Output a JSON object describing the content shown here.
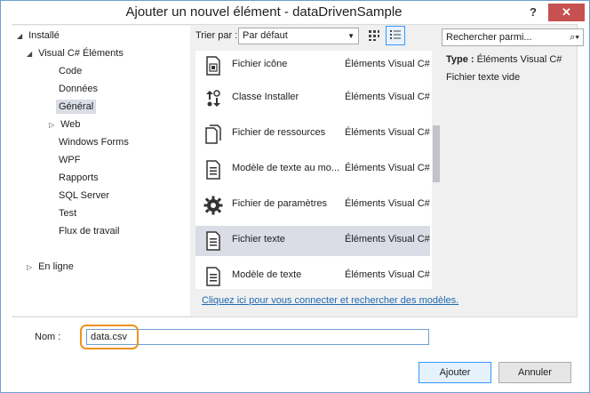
{
  "window": {
    "title": "Ajouter un nouvel élément - dataDrivenSample",
    "help_glyph": "?",
    "close_glyph": "✕"
  },
  "tree": {
    "items": [
      {
        "label": "Installé",
        "toggle": "◢"
      },
      {
        "label": "Visual C# Éléments",
        "toggle": "◢"
      },
      {
        "label": "Code"
      },
      {
        "label": "Données"
      },
      {
        "label": "Général",
        "selected": true
      },
      {
        "label": "Web",
        "toggle": "▷"
      },
      {
        "label": "Windows Forms"
      },
      {
        "label": "WPF"
      },
      {
        "label": "Rapports"
      },
      {
        "label": "SQL Server"
      },
      {
        "label": "Test"
      },
      {
        "label": "Flux de travail"
      },
      {
        "label": "En ligne",
        "toggle": "▷"
      }
    ]
  },
  "toolbar": {
    "sort_label": "Trier par :",
    "sort_value": "Par défaut",
    "search_placeholder": "Rechercher parmi..."
  },
  "templates": [
    {
      "name": "Fichier icône",
      "category": "Éléments Visual C#",
      "icon": "icon-file-icon"
    },
    {
      "name": "Classe Installer",
      "category": "Éléments Visual C#",
      "icon": "installer-class-icon"
    },
    {
      "name": "Fichier de ressources",
      "category": "Éléments Visual C#",
      "icon": "resource-file-icon"
    },
    {
      "name": "Modèle de texte au mo...",
      "category": "Éléments Visual C#",
      "icon": "runtime-text-template-icon"
    },
    {
      "name": "Fichier de paramètres",
      "category": "Éléments Visual C#",
      "icon": "settings-file-icon"
    },
    {
      "name": "Fichier texte",
      "category": "Éléments Visual C#",
      "icon": "text-file-icon",
      "selected": true
    },
    {
      "name": "Modèle de texte",
      "category": "Éléments Visual C#",
      "icon": "text-template-icon"
    }
  ],
  "online_link": "Cliquez ici pour vous connecter et rechercher des modèles.",
  "details": {
    "type_label": "Type :",
    "type_value": "Éléments Visual C#",
    "description": "Fichier texte vide"
  },
  "footer": {
    "name_label": "Nom :",
    "name_value": "data.csv",
    "add_button": "Ajouter",
    "cancel_button": "Annuler"
  },
  "colors": {
    "accent": "#3399ff",
    "selection": "#dadce6",
    "highlight": "#f0921e",
    "close": "#c75050",
    "link": "#1e6ab4"
  }
}
